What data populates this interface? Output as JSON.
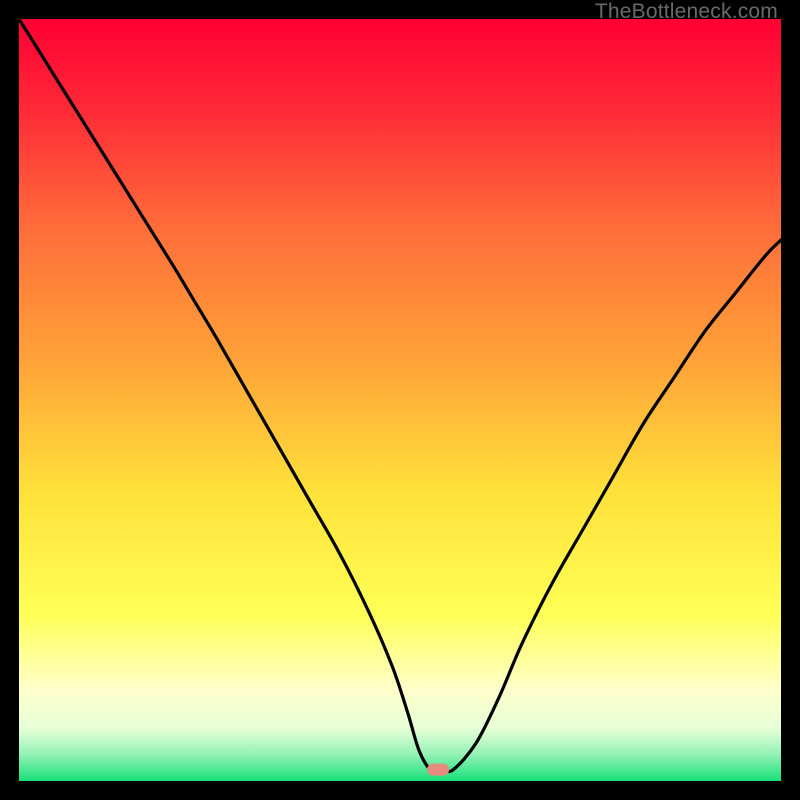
{
  "watermark": "TheBottleneck.com",
  "chart_data": {
    "type": "line",
    "title": "",
    "xlabel": "",
    "ylabel": "",
    "xlim": [
      0,
      100
    ],
    "ylim": [
      0,
      100
    ],
    "grid": false,
    "legend": false,
    "background": {
      "type": "vertical-gradient",
      "stops": [
        {
          "pos": 0.0,
          "color": "#ff0033"
        },
        {
          "pos": 0.12,
          "color": "#ff2a37"
        },
        {
          "pos": 0.28,
          "color": "#ff6f3a"
        },
        {
          "pos": 0.45,
          "color": "#ffa338"
        },
        {
          "pos": 0.62,
          "color": "#ffe13a"
        },
        {
          "pos": 0.78,
          "color": "#ffff55"
        },
        {
          "pos": 0.88,
          "color": "#ffffcb"
        },
        {
          "pos": 0.93,
          "color": "#e8ffd8"
        },
        {
          "pos": 0.965,
          "color": "#94f2b5"
        },
        {
          "pos": 1.0,
          "color": "#18e07a"
        }
      ]
    },
    "series": [
      {
        "name": "bottleneck-curve",
        "color": "#000000",
        "x": [
          0,
          5,
          10,
          15,
          20,
          23,
          26,
          30,
          34,
          38,
          42,
          46,
          49,
          51,
          52.5,
          54,
          55.5,
          57,
          60,
          63,
          66,
          70,
          74,
          78,
          82,
          86,
          90,
          94,
          98,
          100
        ],
        "y": [
          100,
          92,
          84,
          76,
          68,
          63,
          58,
          51,
          44,
          37,
          30,
          22,
          15,
          9,
          4,
          1.5,
          1.5,
          1.5,
          5,
          11,
          18,
          26,
          33,
          40,
          47,
          53,
          59,
          64,
          69,
          71
        ]
      }
    ],
    "marker": {
      "name": "min-point-marker",
      "x": 55,
      "y": 1.5,
      "color": "#e88b7f",
      "shape": "rounded-rect"
    }
  }
}
